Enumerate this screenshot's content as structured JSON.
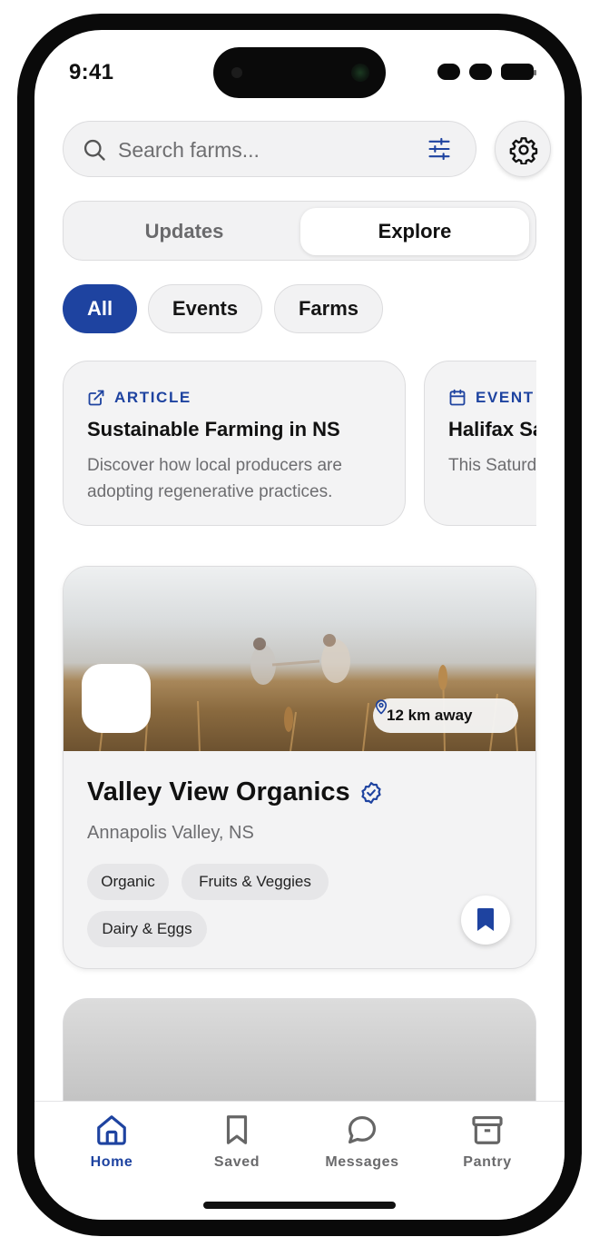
{
  "status": {
    "time": "9:41"
  },
  "search": {
    "placeholder": "Search farms..."
  },
  "segments": {
    "updates": "Updates",
    "explore": "Explore",
    "selected": "Explore"
  },
  "chips": [
    "All",
    "Events",
    "Farms"
  ],
  "news": [
    {
      "tag": "ARTICLE",
      "icon": "external-link-icon",
      "title": "Sustainable Farming in NS",
      "desc": "Discover how local producers are adopting regenerative practices."
    },
    {
      "tag": "EVENT",
      "icon": "calendar-icon",
      "title": "Halifax Sa",
      "desc": "This Saturd from across"
    }
  ],
  "farm": {
    "name": "Valley View Organics",
    "location": "Annapolis Valley, NS",
    "distance": "12 km away",
    "tags": [
      "Organic",
      "Fruits & Veggies",
      "Dairy & Eggs"
    ],
    "saved": true
  },
  "tabs": [
    {
      "label": "Home",
      "icon": "home-icon",
      "active": true
    },
    {
      "label": "Saved",
      "icon": "bookmark-icon",
      "active": false
    },
    {
      "label": "Messages",
      "icon": "chat-bubble-icon",
      "active": false
    },
    {
      "label": "Pantry",
      "icon": "archive-box-icon",
      "active": false
    }
  ],
  "colors": {
    "accent": "#1e43a0",
    "surface": "#f2f2f3",
    "muted_text": "#6d6d70"
  }
}
